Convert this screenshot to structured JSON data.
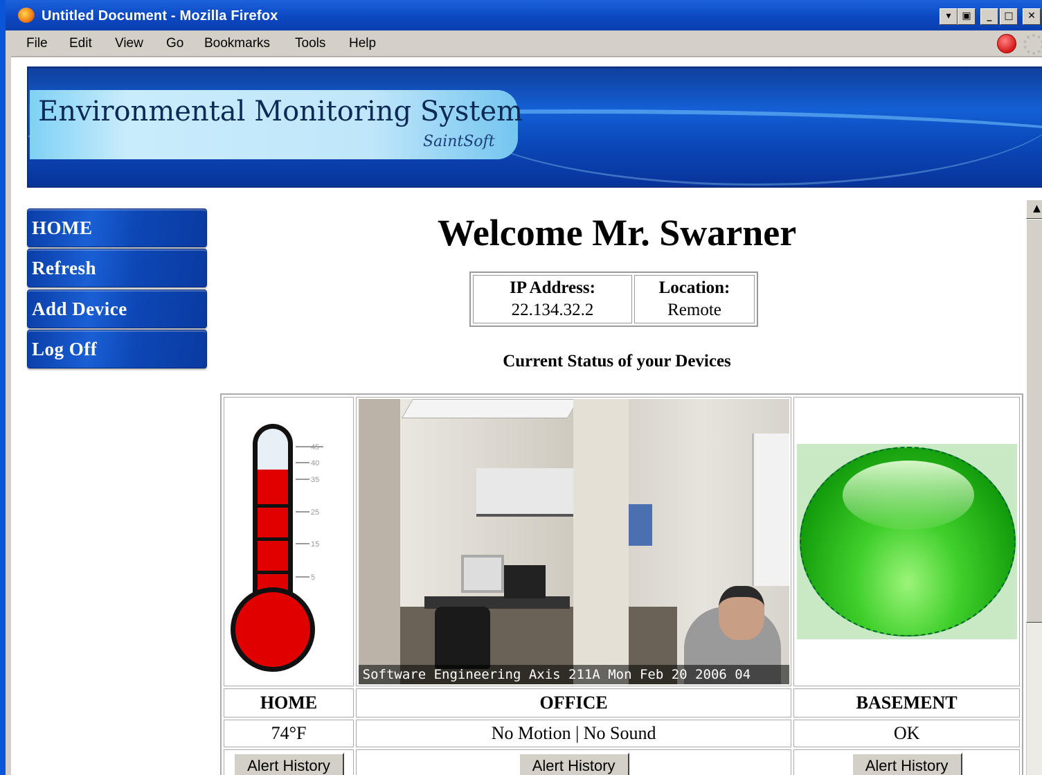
{
  "window": {
    "title": "Untitled Document - Mozilla Firefox",
    "controls": [
      "▾",
      "▣",
      "_",
      "□",
      "✕"
    ]
  },
  "menubar": {
    "items": [
      "File",
      "Edit",
      "View",
      "Go",
      "Bookmarks",
      "Tools",
      "Help"
    ]
  },
  "banner": {
    "title": "Environmental Monitoring System",
    "subtitle": "SaintSoft"
  },
  "sidebar": {
    "items": [
      {
        "label": "HOME"
      },
      {
        "label": "Refresh"
      },
      {
        "label": "Add Device"
      },
      {
        "label": "Log Off"
      }
    ]
  },
  "main": {
    "welcome": "Welcome Mr. Swarner",
    "info": {
      "ip_label": "IP Address:",
      "ip_value": "22.134.32.2",
      "location_label": "Location:",
      "location_value": "Remote"
    },
    "status_heading": "Current Status of your Devices",
    "devices": [
      {
        "name": "HOME",
        "status": "74°F",
        "button": "Alert History"
      },
      {
        "name": "OFFICE",
        "status": "No Motion | No Sound",
        "button": "Alert History"
      },
      {
        "name": "BASEMENT",
        "status": "OK",
        "button": "Alert History"
      }
    ],
    "camera_caption": "Software Engineering Axis 211A   Mon Feb 20 2006 04",
    "thermometer": {
      "scale_labels": [
        "45",
        "40",
        "35",
        "25",
        "15",
        "5"
      ],
      "fill_fraction": 0.8
    }
  },
  "colors": {
    "banner_blue": "#1360d6",
    "thermo_red": "#e10000",
    "orb_green": "#3fcf2a"
  }
}
